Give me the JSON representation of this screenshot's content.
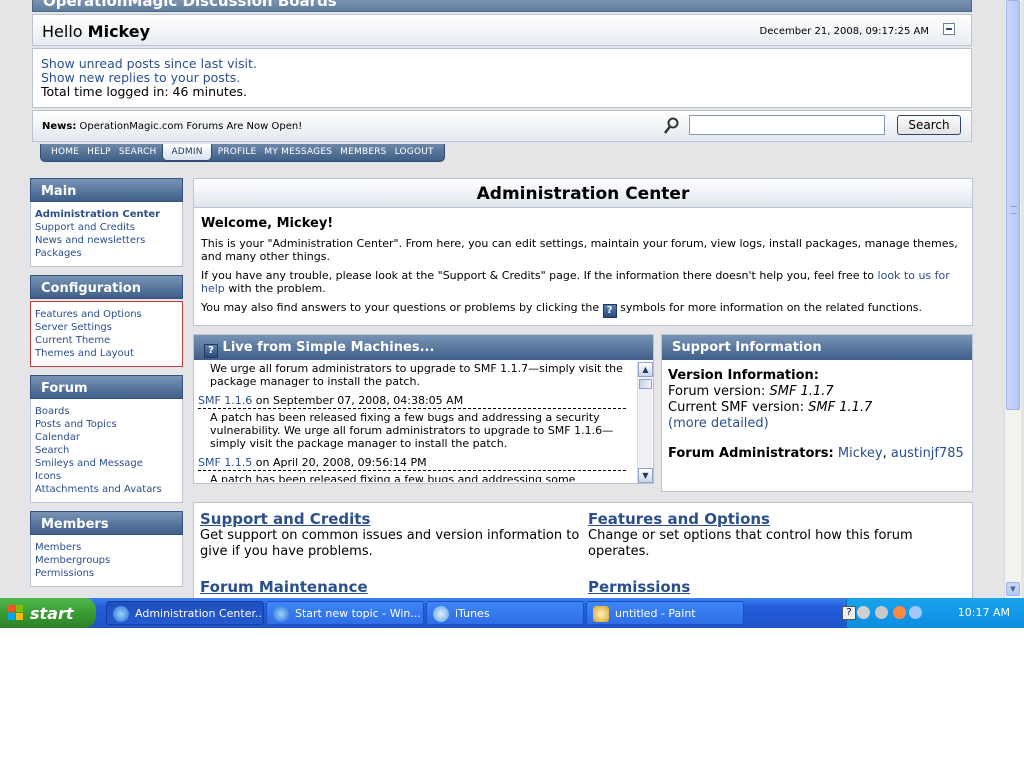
{
  "header": {
    "site_title": "OperationMagic Discussion Boards",
    "greeting": "Hello",
    "username": "Mickey",
    "date": "December 21, 2008, 09:17:25 AM"
  },
  "userinfo": {
    "unread": "Show unread posts since last visit.",
    "replies": "Show new replies to your posts.",
    "time_logged": "Total time logged in: 46 minutes."
  },
  "news": {
    "label": "News:",
    "text": "OperationMagic.com Forums Are Now Open!",
    "search_button": "Search",
    "search_value": ""
  },
  "menu": [
    "HOME",
    "HELP",
    "SEARCH",
    "ADMIN",
    "PROFILE",
    "MY MESSAGES",
    "MEMBERS",
    "LOGOUT"
  ],
  "sidebar": {
    "main": {
      "title": "Main",
      "items": [
        "Administration Center",
        "Support and Credits",
        "News and newsletters",
        "Packages"
      ]
    },
    "configuration": {
      "title": "Configuration",
      "items": [
        "Features and Options",
        "Server Settings",
        "Current Theme",
        "Themes and Layout"
      ]
    },
    "forum": {
      "title": "Forum",
      "items": [
        "Boards",
        "Posts and Topics",
        "Calendar",
        "Search",
        "Smileys and Message",
        "Icons",
        "Attachments and Avatars"
      ]
    },
    "members": {
      "title": "Members",
      "items": [
        "Members",
        "Membergroups",
        "Permissions"
      ]
    }
  },
  "admin": {
    "title": "Administration Center",
    "welcome": "Welcome, Mickey!",
    "p1": "This is your \"Administration Center\". From here, you can edit settings, maintain your forum, view logs, install packages, manage themes, and many other things.",
    "p2a": "If you have any trouble, please look at the \"Support & Credits\" page. If the information there doesn't help you, feel free to",
    "p2link": "look to us for help",
    "p2b": "with the problem.",
    "p3a": "You may also find answers to your questions or problems by clicking the",
    "p3b": "symbols for more information on the related functions."
  },
  "live": {
    "title": "Live from Simple Machines...",
    "top_text": "We urge all forum administrators to upgrade to SMF 1.1.7—simply visit the package manager to install the patch.",
    "entries": [
      {
        "version": "SMF 1.1.6",
        "date": "on September 07, 2008, 04:38:05 AM",
        "text": "A patch has been released fixing a few bugs and addressing a security vulnerability. We urge all forum administrators to upgrade to SMF 1.1.6—simply visit the package manager to install the patch."
      },
      {
        "version": "SMF 1.1.5",
        "date": "on April 20, 2008, 09:56:14 PM",
        "text": "A patch has been released fixing a few bugs and addressing some"
      }
    ]
  },
  "support": {
    "title": "Support Information",
    "version_info": "Version Information:",
    "forum_version_label": "Forum version:",
    "forum_version": "SMF 1.1.7",
    "current_label": "Current SMF version:",
    "current_version": "SMF 1.1.7",
    "more": "(more detailed)",
    "admins_label": "Forum Administrators:",
    "admins": [
      "Mickey",
      "austinjf785"
    ]
  },
  "bottom": [
    {
      "title": "Support and Credits",
      "desc": "Get support on common issues and version information to give if you have problems."
    },
    {
      "title": "Features and Options",
      "desc": "Change or set options that control how this forum operates."
    },
    {
      "title": "Forum Maintenance",
      "desc": ""
    },
    {
      "title": "Permissions",
      "desc": ""
    }
  ],
  "taskbar": {
    "start": "start",
    "tasks": [
      "Administration Center...",
      "Start new topic - Win...",
      "iTunes",
      "untitled - Paint"
    ],
    "clock": "10:17 AM"
  },
  "colors": {
    "link": "#2b4f8c",
    "panel_header": "#3e5f8a",
    "taskbar": "#245edb",
    "start": "#3a9b34"
  }
}
